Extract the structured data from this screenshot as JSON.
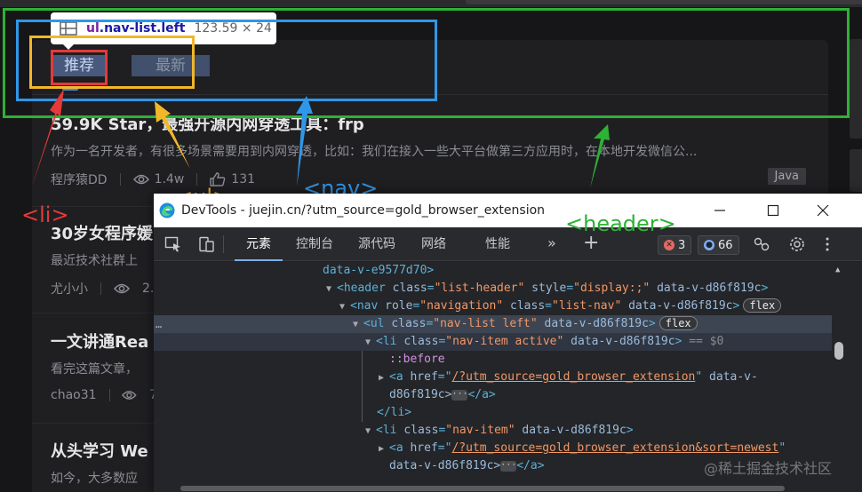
{
  "page": {
    "tabs": [
      {
        "label": "推荐"
      },
      {
        "label": "最新"
      }
    ],
    "articles": [
      {
        "title": "59.9K Star，最强开源内网穿透工具：frp",
        "desc": "作为一名开发者，有很多场景需要用到内网穿透，比如：我们在接入一些大平台做第三方应用时，在本地开发微信公...",
        "author": "程序猿DD",
        "views": "1.4w",
        "likes": "131",
        "tag": "Java"
      },
      {
        "title": "30岁女程序媛",
        "desc": "最近技术社群上",
        "author": "尤小小",
        "views": "2."
      },
      {
        "title": "一文讲通Rea",
        "desc": "看完这篇文章，",
        "author": "chao31",
        "views": "7"
      },
      {
        "title": "从头学习 We",
        "desc": "如今，大多数应"
      }
    ]
  },
  "tooltip": {
    "tag": "ul",
    "classes": ".nav-list.left",
    "size": "123.59 × 24"
  },
  "annotations": {
    "li": "<li>",
    "ul": "<ul>",
    "nav": "<nav>",
    "header": "<header>",
    "colors": {
      "li": "#e43a3a",
      "ul": "#f0b72a",
      "nav": "#2f97e8",
      "header": "#2eb135"
    }
  },
  "devtools": {
    "title": "DevTools - juejin.cn/?utm_source=gold_browser_extension",
    "tabs": [
      "元素",
      "控制台",
      "源代码",
      "网络",
      "性能"
    ],
    "active_tab": "元素",
    "error_count": "3",
    "message_count": "66",
    "dom": {
      "l0": "data-v-e9577d70>",
      "l1_tag": "header",
      "l1_a1n": "class",
      "l1_a1v": "\"list-header\"",
      "l1_a2n": "style",
      "l1_a2v": "\"display:;\"",
      "l1_a3n": "data-v-d86f819c",
      "l2_tag": "nav",
      "l2_a1n": "role",
      "l2_a1v": "\"navigation\"",
      "l2_a2n": "class",
      "l2_a2v": "\"list-nav\"",
      "l2_a3n": "data-v-d86f819c",
      "l2_pill": "flex",
      "l3_tag": "ul",
      "l3_a1n": "class",
      "l3_a1v": "\"nav-list left\"",
      "l3_a2n": "data-v-d86f819c",
      "l3_pill": "flex",
      "l4_tag": "li",
      "l4_a1n": "class",
      "l4_a1v": "\"nav-item active\"",
      "l4_a2n": "data-v-d86f819c",
      "l4_dollar": "== $0",
      "l5": "::before",
      "l6_tag": "a",
      "l6_a1n": "href",
      "l6_a1v": "/?utm_source=gold_browser_extension",
      "l6_a2n": "data-v-",
      "l7": "d86f819c>",
      "l7_close": "</a>",
      "l8": "</li>",
      "l9_tag": "li",
      "l9_a1n": "class",
      "l9_a1v": "\"nav-item\"",
      "l9_a2n": "data-v-d86f819c",
      "l10_tag": "a",
      "l10_a1n": "href",
      "l10_a1v": "/?utm_source=gold_browser_extension&sort=newest",
      "l11": "data-v-d86f819c>",
      "l11_close": "</a>"
    }
  },
  "watermark": "@稀土掘金技术社区"
}
